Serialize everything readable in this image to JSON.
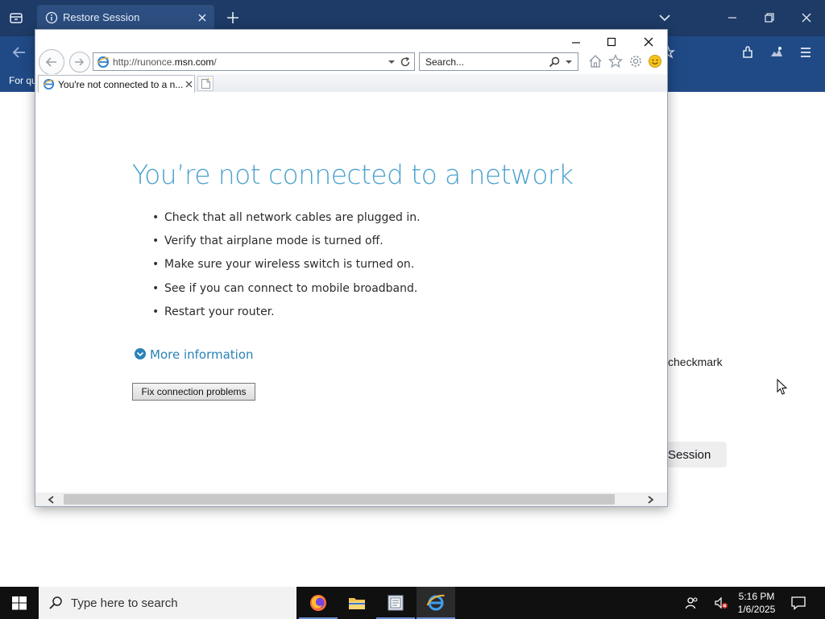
{
  "firefox": {
    "tab_title": "Restore Session",
    "notification_text": "For quick access, place your bookmarks here on the bookmarks toolbar.",
    "checkmark_text": "checkmark",
    "restore_button_label": "Session",
    "colors": {
      "titlebar": "#1d3b66",
      "toolbar": "#204a86"
    }
  },
  "ie": {
    "address_prefix": "http://runonce.",
    "address_domain": "msn.com",
    "address_suffix": "/",
    "search_placeholder": "Search...",
    "tab_title": "You're not connected to a n...",
    "heading": "You’re not connected to a network",
    "bullets": [
      "Check that all network cables are plugged in.",
      "Verify that airplane mode is turned off.",
      "Make sure your wireless switch is turned on.",
      "See if you can connect to mobile broadband.",
      "Restart your router."
    ],
    "more_info_label": "More information",
    "fix_button_label": "Fix connection problems",
    "colors": {
      "heading": "#4aa2cf",
      "link": "#2a82b8"
    }
  },
  "taskbar": {
    "search_placeholder": "Type here to search",
    "apps": [
      "firefox-icon",
      "file-explorer-icon",
      "notepad-icon",
      "internet-explorer-icon"
    ],
    "clock": {
      "time": "5:16 PM",
      "date": "1/6/2025"
    }
  }
}
